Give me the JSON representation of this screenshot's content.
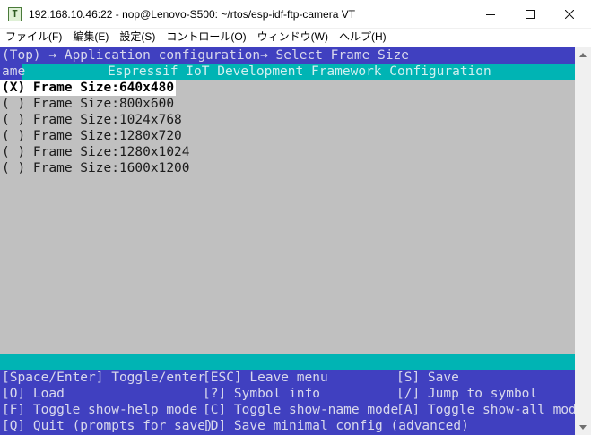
{
  "window": {
    "title": "192.168.10.46:22 - nop@Lenovo-S500: ~/rtos/esp-idf-ftp-camera VT",
    "icon_letter": "T",
    "icon": "terminal-app-icon"
  },
  "menu": [
    {
      "label": "ファイル(F)"
    },
    {
      "label": "編集(E)"
    },
    {
      "label": "設定(S)"
    },
    {
      "label": "コントロール(O)"
    },
    {
      "label": "ウィンドウ(W)"
    },
    {
      "label": "ヘルプ(H)"
    }
  ],
  "terminal": {
    "breadcrumb": "(Top) → Application configuration→ Select Frame Size",
    "header_left": "ame",
    "header_title": "Espressif IoT Development Framework Configuration",
    "options": [
      {
        "text": "(X) Frame Size:640x480",
        "selected": true
      },
      {
        "text": "( ) Frame Size:800x600",
        "selected": false
      },
      {
        "text": "( ) Frame Size:1024x768",
        "selected": false
      },
      {
        "text": "( ) Frame Size:1280x720",
        "selected": false
      },
      {
        "text": "( ) Frame Size:1280x1024",
        "selected": false
      },
      {
        "text": "( ) Frame Size:1600x1200",
        "selected": false
      }
    ],
    "help": [
      [
        "[Space/Enter] Toggle/enter",
        "[ESC] Leave menu",
        "[S] Save"
      ],
      [
        "[O] Load",
        "[?] Symbol info",
        "[/] Jump to symbol"
      ],
      [
        "[F] Toggle show-help mode",
        "[C] Toggle show-name mode",
        "[A] Toggle show-all mode"
      ],
      [
        "[Q] Quit (prompts for save)",
        "[D] Save minimal config (advanced)",
        ""
      ]
    ]
  },
  "colors": {
    "terminal_bg": "#c0c0c0",
    "blue_bar": "#4040c0",
    "cyan_bar": "#00b4b4",
    "selected_bg": "#ffffff"
  }
}
